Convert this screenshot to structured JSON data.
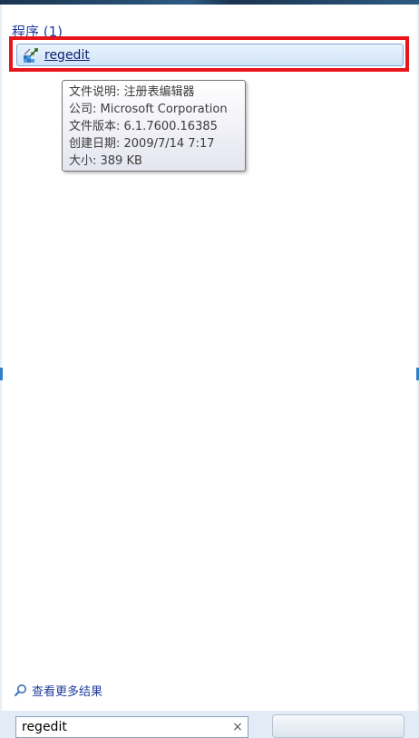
{
  "results": {
    "header": "程序 (1)",
    "items": [
      {
        "label": "regedit",
        "icon": "registry-editor-icon"
      }
    ]
  },
  "tooltip": {
    "lines": [
      "文件说明: 注册表编辑器",
      "公司: Microsoft Corporation",
      "文件版本: 6.1.7600.16385",
      "创建日期: 2009/7/14 7:17",
      "大小: 389 KB"
    ]
  },
  "see_more": {
    "label": "查看更多结果",
    "icon": "search-icon"
  },
  "search": {
    "value": "regedit",
    "clear_icon": "close-icon"
  },
  "colors": {
    "highlight": "#e8141b",
    "link": "#1e3c9c",
    "selection": "#cfe3f8"
  }
}
